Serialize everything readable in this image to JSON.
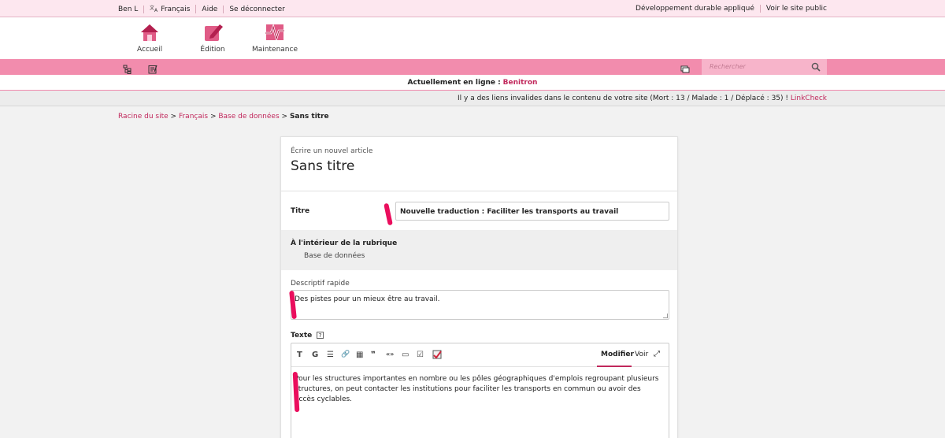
{
  "topbar": {
    "user": "Ben L",
    "language": "Français",
    "help": "Aide",
    "logout": "Se déconnecter",
    "site_name": "Développement durable appliqué",
    "view_site": "Voir le site public"
  },
  "nav": {
    "home": "Accueil",
    "edit": "Édition",
    "maintenance": "Maintenance"
  },
  "search": {
    "placeholder": "Rechercher"
  },
  "online": {
    "label": "Actuellement en ligne :",
    "user": "Benitron"
  },
  "alert": {
    "text": "Il y a des liens invalides dans le contenu de votre site (Mort : 13 / Malade : 1 / Déplacé : 35) !",
    "link": "LinkCheck"
  },
  "breadcrumb": {
    "root": "Racine du site",
    "lang": "Français",
    "section": "Base de données",
    "current": "Sans titre",
    "sep": ">"
  },
  "article": {
    "subtitle": "Écrire un nouvel article",
    "heading": "Sans titre",
    "title_label": "Titre",
    "title_value": "Nouvelle traduction : Faciliter les transports au travail",
    "rubrique_label": "À l'intérieur de la rubrique",
    "rubrique_value": "Base de données",
    "desc_label": "Descriptif rapide",
    "desc_value": "Des pistes pour un mieux être au travail.",
    "text_label": "Texte",
    "help_glyph": "?",
    "tab_edit": "Modifier",
    "tab_view": "Voir",
    "body": "Pour les structures importantes en nombre ou les pôles géographiques d'emplois regroupant plusieurs structures, on peut contacter les institutions pour faciliter les transports en commun ou avoir des accès cyclables."
  },
  "toolbar_glyphs": {
    "italic": "T",
    "bold": "G",
    "list": "☰",
    "link": "🔗",
    "table": "▦",
    "quote": "❞",
    "guillemets": "«»",
    "note": "▭",
    "check": "☑",
    "expand": "⤢"
  },
  "colors": {
    "accent": "#c1285c",
    "pinkbar": "#f28cad",
    "marker": "#ea0e5d"
  }
}
